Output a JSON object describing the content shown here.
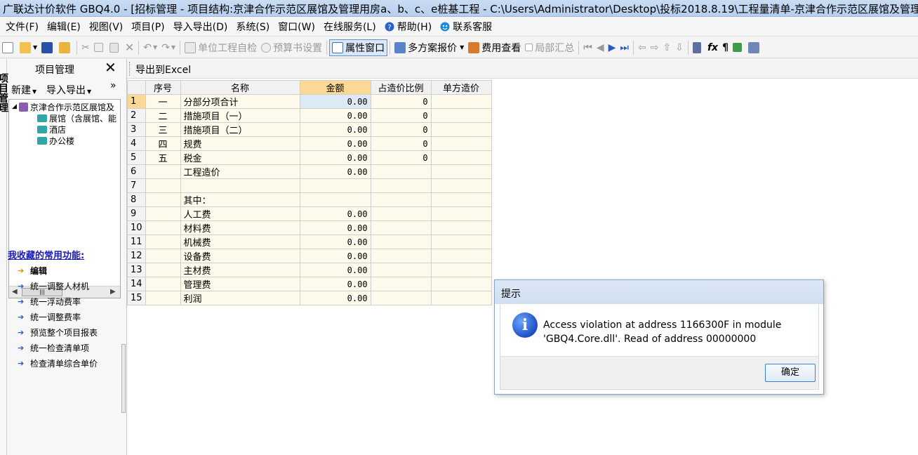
{
  "window": {
    "title": "广联达计价软件 GBQ4.0 - [招标管理 - 项目结构:京津合作示范区展馆及管理用房a、b、c、e桩基工程 - C:\\Users\\Administrator\\Desktop\\投标2018.8.19\\工程量清单-京津合作示范区展馆及管理用房"
  },
  "menu": {
    "items": [
      {
        "label": "文件(F)"
      },
      {
        "label": "编辑(E)"
      },
      {
        "label": "视图(V)"
      },
      {
        "label": "项目(P)"
      },
      {
        "label": "导入导出(D)"
      },
      {
        "label": "系统(S)"
      },
      {
        "label": "窗口(W)"
      },
      {
        "label": "在线服务(L)"
      },
      {
        "label": "帮助(H)",
        "icon": "help-icon"
      },
      {
        "label": "联系客服",
        "icon": "support-icon"
      }
    ]
  },
  "toolbar": {
    "unit_check": "单位工程自检",
    "budget_settings": "预算书设置",
    "property_window": "属性窗口",
    "multi_quote": "多方案报价",
    "fee_view": "费用查看",
    "partial_summary": "局部汇总"
  },
  "left_panel": {
    "vertical_tab": "项目管理",
    "title": "项目管理",
    "close": "✕",
    "new_btn": "新建",
    "import_export_btn": "导入导出",
    "more": "»",
    "tree": {
      "root": "京津合作示范区展馆及",
      "children": [
        "展馆（含展馆、能",
        "酒店",
        "办公楼"
      ]
    },
    "favorites_title": "我收藏的常用功能:",
    "favorites": [
      "编辑",
      "统一调整人材机",
      "统一浮动费率",
      "统一调整费率",
      "预览整个项目报表",
      "统一检查清单项",
      "检查清单综合单价"
    ]
  },
  "right_panel": {
    "export_excel": "导出到Excel"
  },
  "grid": {
    "columns": [
      "序号",
      "名称",
      "金额",
      "占造价比例",
      "单方造价"
    ],
    "rows": [
      {
        "n": "1",
        "no": "一",
        "name": "分部分项合计",
        "amount": "0.00",
        "ratio": "0"
      },
      {
        "n": "2",
        "no": "二",
        "name": "措施项目（一）",
        "amount": "0.00",
        "ratio": "0"
      },
      {
        "n": "3",
        "no": "三",
        "name": "措施项目（二）",
        "amount": "0.00",
        "ratio": "0"
      },
      {
        "n": "4",
        "no": "四",
        "name": "规费",
        "amount": "0.00",
        "ratio": "0"
      },
      {
        "n": "5",
        "no": "五",
        "name": "税金",
        "amount": "0.00",
        "ratio": "0"
      },
      {
        "n": "6",
        "no": "",
        "name": "工程造价",
        "amount": "0.00",
        "ratio": ""
      },
      {
        "n": "7",
        "no": "",
        "name": "",
        "amount": "",
        "ratio": ""
      },
      {
        "n": "8",
        "no": "",
        "name": "其中：",
        "amount": "",
        "ratio": ""
      },
      {
        "n": "9",
        "no": "",
        "name": "人工费",
        "amount": "0.00",
        "ratio": ""
      },
      {
        "n": "10",
        "no": "",
        "name": "材料费",
        "amount": "0.00",
        "ratio": ""
      },
      {
        "n": "11",
        "no": "",
        "name": "机械费",
        "amount": "0.00",
        "ratio": ""
      },
      {
        "n": "12",
        "no": "",
        "name": "设备费",
        "amount": "0.00",
        "ratio": ""
      },
      {
        "n": "13",
        "no": "",
        "name": "主材费",
        "amount": "0.00",
        "ratio": ""
      },
      {
        "n": "14",
        "no": "",
        "name": "管理费",
        "amount": "0.00",
        "ratio": ""
      },
      {
        "n": "15",
        "no": "",
        "name": "利润",
        "amount": "0.00",
        "ratio": ""
      }
    ]
  },
  "dialog": {
    "title": "提示",
    "message_line1": "Access violation at address 1166300F in module",
    "message_line2": "'GBQ4.Core.dll'. Read of address 00000000",
    "ok": "确定"
  },
  "colors": {
    "grid_background": "#fdfaec",
    "sorted_header": "#fbd893",
    "favorites_title": "#1a1ab4",
    "dialog_title": "#cfdff2"
  }
}
